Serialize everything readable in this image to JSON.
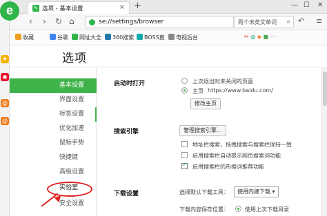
{
  "browser": {
    "tab_title": "选项 - 基本设置",
    "tab_close": "×",
    "tab_add": "+",
    "url": "se://settings/browser",
    "search_placeholder": "两个未英文单词",
    "nav": {
      "back": "‹",
      "forward": "›",
      "refresh": "↻",
      "home": "⌂"
    },
    "window_controls": {
      "minimize": "—",
      "restore": "☐",
      "close": "✕"
    }
  },
  "bookmarks": [
    {
      "label": "收藏",
      "color": "#f0a020"
    },
    {
      "label": "谷歌",
      "color": "#4285f4"
    },
    {
      "label": "网址大全",
      "color": "#2fb54a"
    },
    {
      "label": "360搜索",
      "color": "#27a"
    },
    {
      "label": "BOSS直",
      "color": "#1aa"
    },
    {
      "label": "电视后台",
      "color": "#888"
    }
  ],
  "page": {
    "title": "选项"
  },
  "sidebar": {
    "items": [
      {
        "label": "基本设置"
      },
      {
        "label": "界面设置"
      },
      {
        "label": "标签设置"
      },
      {
        "label": "优化加速"
      },
      {
        "label": "鼠标手势"
      },
      {
        "label": "快捷键"
      },
      {
        "label": "高级设置"
      },
      {
        "label": "实验室"
      },
      {
        "label": "安全设置"
      }
    ]
  },
  "startup": {
    "label": "启动时打开",
    "option1": "上次退出时未关闭的页面",
    "option2_label": "主页",
    "option2_url": "https://www.baidu.com/",
    "edit_home_button": "修改主页"
  },
  "search_engine": {
    "label": "搜索引擎",
    "manage_button": "管理搜索引擎...",
    "options": [
      "地址栏搜索，拖拽搜索与搜索栏保持一致",
      "启用搜索栏自动提示网页搜索词功能",
      "启用搜索栏的热搜词推荐功能"
    ]
  },
  "download": {
    "label": "下载设置",
    "tool_label": "选择默认下载工具：",
    "tool_value": "使用内建下载",
    "save_location_label": "下载内容保存位置：",
    "save_location_value": "使用上次下载目录"
  }
}
